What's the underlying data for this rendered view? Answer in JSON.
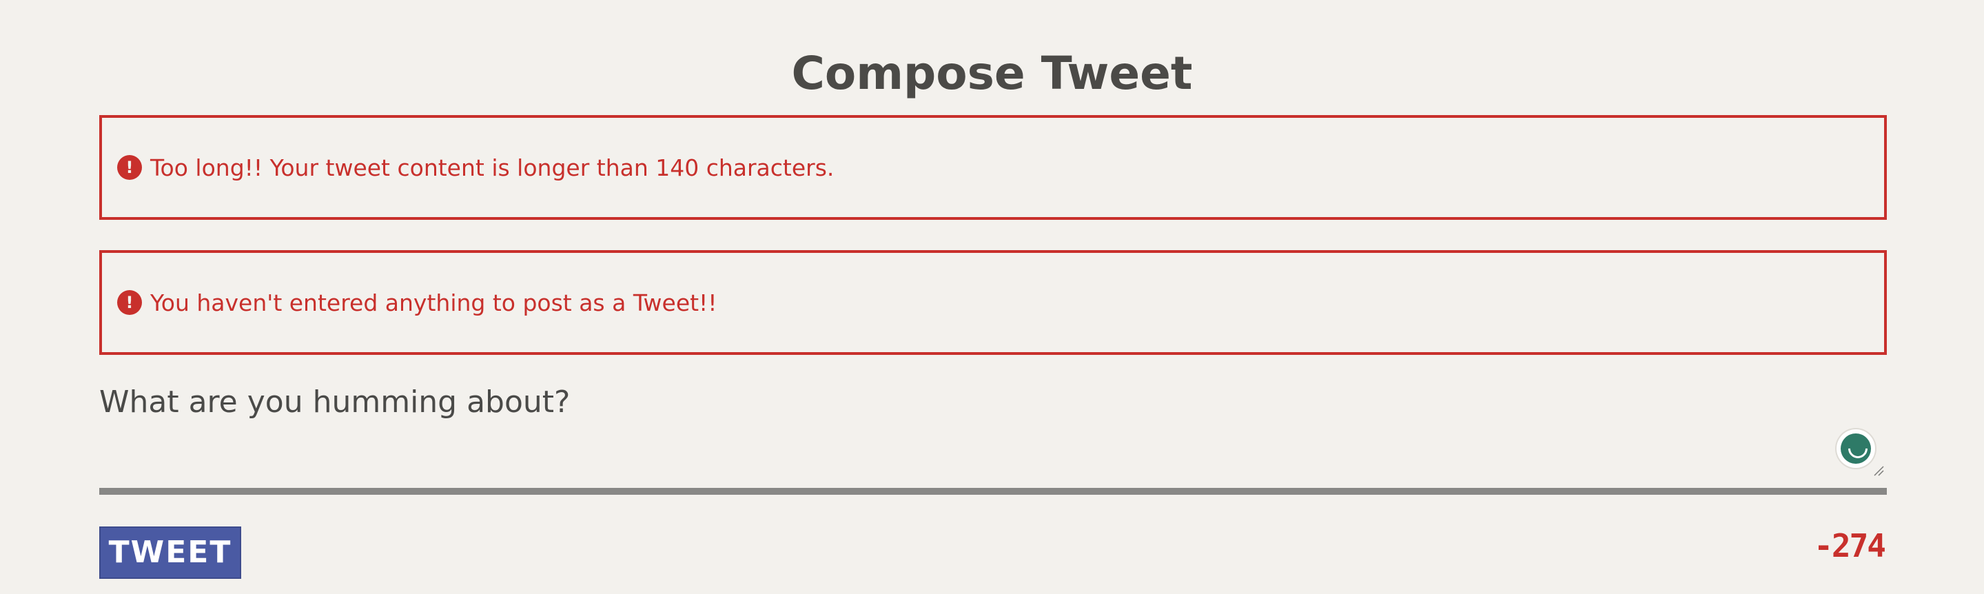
{
  "header": {
    "title": "Compose Tweet"
  },
  "errors": [
    {
      "icon": "exclamation-circle-icon",
      "glyph": "!",
      "message": "Too long!! Your tweet content is longer than 140 characters."
    },
    {
      "icon": "exclamation-circle-icon",
      "glyph": "!",
      "message": "You haven't entered anything to post as a Tweet!!"
    }
  ],
  "composer": {
    "placeholder": "What are you humming about?",
    "value": "",
    "assistant_icon": "grammarly-icon",
    "resize_icon": "resize-grip-icon"
  },
  "footer": {
    "tweet_label": "TWEET",
    "char_count": "-274"
  },
  "colors": {
    "background": "#f3f1ed",
    "text": "#4a4a48",
    "error": "#c8302c",
    "button": "#4a5aa3",
    "divider": "#888886"
  }
}
